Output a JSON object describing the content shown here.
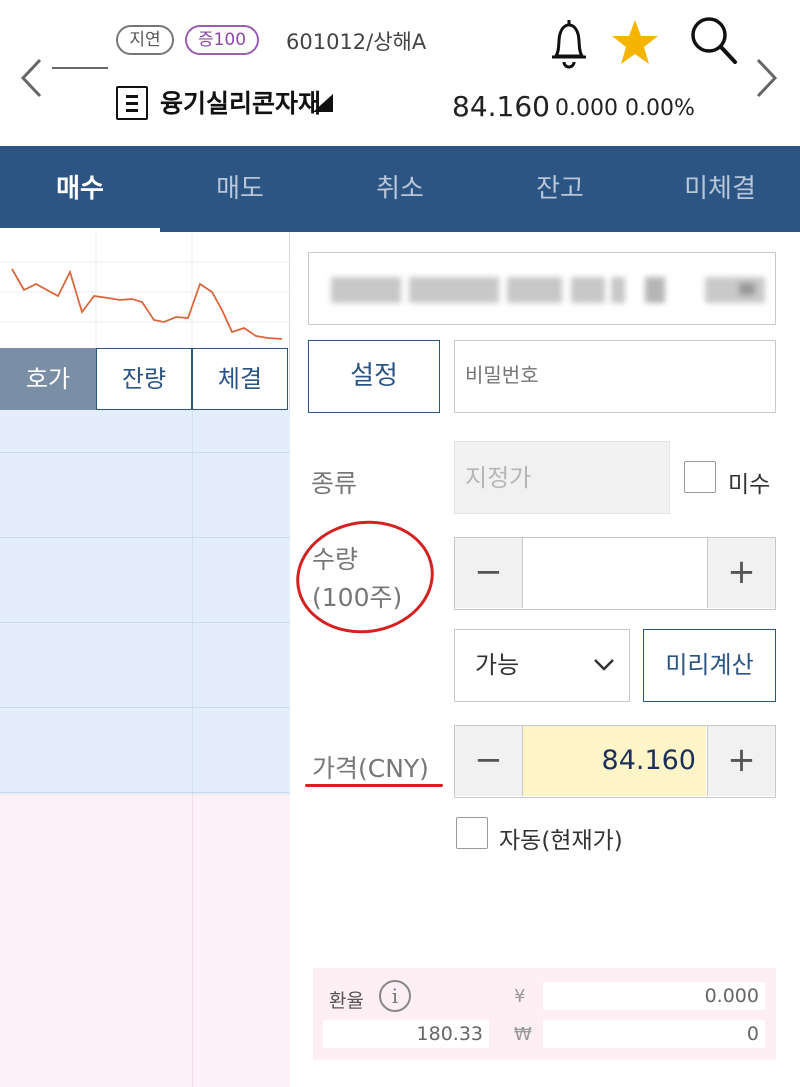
{
  "header": {
    "badge_delay": "지연",
    "badge_level": "증100",
    "stock_code": "601012/상해A",
    "stock_name": "융기실리콘자재",
    "price": "84.160",
    "change": "0.000",
    "change_rate": "0.00%"
  },
  "tabs": [
    "매수",
    "매도",
    "취소",
    "잔고",
    "미체결"
  ],
  "active_tab": "매수",
  "sub_tabs": [
    "호가",
    "잔량",
    "체결"
  ],
  "order_form": {
    "setting_label": "설정",
    "password_placeholder": "비밀번호",
    "type_label": "종류",
    "type_value": "지정가",
    "unpaid_label": "미수",
    "quantity_label_line1": "수량",
    "quantity_label_line2": "(100주)",
    "quantity_value": "",
    "available_option": "가능",
    "precalc_label": "미리계산",
    "price_label": "가격(CNY)",
    "price_value": "84.160",
    "auto_label": "자동(현재가)",
    "minus_symbol": "−",
    "plus_symbol": "+"
  },
  "fx": {
    "label": "환율",
    "info_symbol": "i",
    "rate": "180.33",
    "yuan_symbol": "¥",
    "yuan_amount": "0.000",
    "won_symbol": "₩",
    "won_amount": "0"
  },
  "colors": {
    "tabbar": "#2d5583",
    "annotation": "#d62121",
    "star": "#f5b400",
    "chart_line": "#d9673b"
  }
}
